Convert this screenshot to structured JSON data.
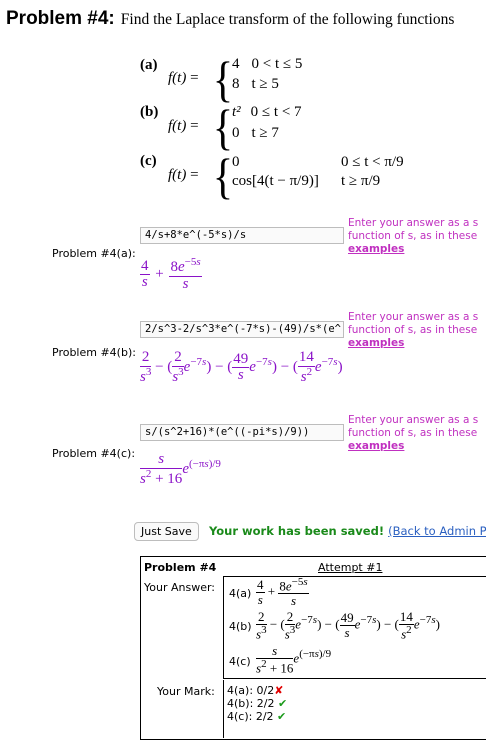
{
  "header": {
    "problem_label": "Problem #4:",
    "prompt": "Find the Laplace transform of the following functions"
  },
  "parts": [
    {
      "label": "(a)",
      "fx": "f(t)",
      "cases": [
        {
          "expr": "4",
          "cond": "0 < t ≤ 5"
        },
        {
          "expr": "8",
          "cond": "t ≥ 5"
        }
      ]
    },
    {
      "label": "(b)",
      "fx": "f(t)",
      "cases": [
        {
          "expr": "t²",
          "cond": "0 ≤ t < 7"
        },
        {
          "expr": "0",
          "cond": "t ≥ 7"
        }
      ]
    },
    {
      "label": "(c)",
      "fx": "f(t)",
      "cases": [
        {
          "expr": "0",
          "cond": "0 ≤ t < π/9"
        },
        {
          "expr": "cos[4(t − π/9)]",
          "cond": "t ≥ π/9"
        }
      ]
    }
  ],
  "answers": [
    {
      "label": "Problem #4(a):",
      "input_value": "4/s+8*e^(-5*s)/s"
    },
    {
      "label": "Problem #4(b):",
      "input_value": "2/s^3-2/s^3*e^(-7*s)-(49)/s*(e^"
    },
    {
      "label": "Problem #4(c):",
      "input_value": "s/(s^2+16)*(e^((-pi*s)/9))"
    }
  ],
  "hint": {
    "line1": "Enter your answer as a s",
    "line2": "function of s, as in these",
    "link": "examples"
  },
  "save": {
    "button_label": "Just Save",
    "saved_message": "Your work has been saved!",
    "admin_link": "(Back to Admin Pac"
  },
  "results": {
    "title": "Problem #4",
    "attempt": "Attempt #1",
    "your_answer_label": "Your Answer:",
    "your_mark_label": "Your Mark:",
    "answer_labels": [
      "4(a)",
      "4(b)",
      "4(c)"
    ],
    "marks": [
      {
        "label": "4(a)",
        "score": "0/2",
        "status": "wrong"
      },
      {
        "label": "4(b)",
        "score": "2/2",
        "status": "correct"
      },
      {
        "label": "4(c)",
        "score": "2/2",
        "status": "correct"
      }
    ]
  },
  "colors": {
    "math": "#8a12c8",
    "hint": "#c030c0",
    "saved": "#1a8a1a",
    "link": "#2a5fc0",
    "correct": "#1a9a1a",
    "wrong": "#e00000"
  }
}
